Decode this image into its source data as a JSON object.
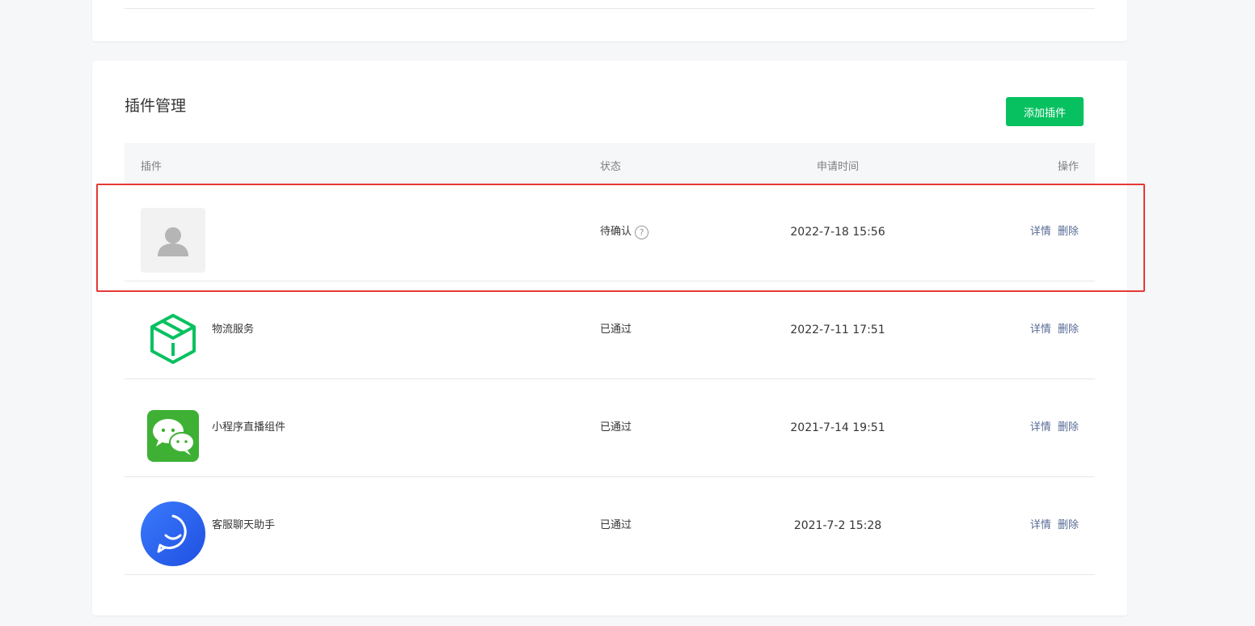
{
  "section": {
    "title": "插件管理",
    "add_button_label": "添加插件"
  },
  "table": {
    "headers": {
      "plugin": "插件",
      "status": "状态",
      "apply_time": "申请时间",
      "ops": "操作"
    },
    "rows": [
      {
        "name": "",
        "icon": "default-avatar-icon",
        "status": "待确认",
        "has_help": true,
        "time": "2022-7-18 15:56",
        "detail": "详情",
        "delete": "删除"
      },
      {
        "name": "物流服务",
        "icon": "logistics-box-icon",
        "status": "已通过",
        "has_help": false,
        "time": "2022-7-11 17:51",
        "detail": "详情",
        "delete": "删除"
      },
      {
        "name": "小程序直播组件",
        "icon": "wechat-icon",
        "status": "已通过",
        "has_help": false,
        "time": "2021-7-14 19:51",
        "detail": "详情",
        "delete": "删除"
      },
      {
        "name": "客服聊天助手",
        "icon": "chat-assistant-icon",
        "status": "已通过",
        "has_help": false,
        "time": "2021-7-2 15:28",
        "detail": "详情",
        "delete": "删除"
      }
    ]
  },
  "help_glyph": "?",
  "colors": {
    "primary_green": "#07c160",
    "link": "#576b95",
    "highlight_red": "#e53935"
  }
}
